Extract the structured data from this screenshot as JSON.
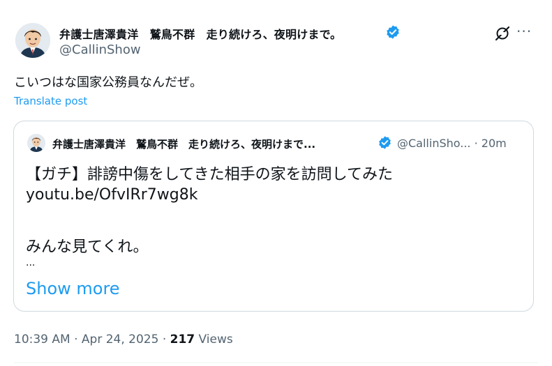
{
  "post": {
    "author_name": "弁護士唐澤貴洋　鷲鳥不群　走り続けろ、夜明けまで。",
    "author_handle": "@CallinShow",
    "text": "こいつはな国家公務員なんだぜ。",
    "translate_label": "Translate post",
    "more_icon": "more-icon",
    "grok_icon": "grok-icon"
  },
  "quote": {
    "author_name": "弁護士唐澤貴洋　鷲鳥不群　走り続けろ、夜明けまで...",
    "author_handle": "@CallinSho...",
    "time": "· 20m",
    "line1": "【ガチ】誹謗中傷をしてきた相手の家を訪問してみた",
    "line2": "youtu.be/OfvIRr7wg8k",
    "line3": "みんな見てくれ。",
    "ellipsis": "...",
    "show_more": "Show more"
  },
  "meta": {
    "timestamp": "10:39 AM · Apr 24, 2025 · ",
    "views_count": "217",
    "views_label": " Views"
  },
  "colors": {
    "accent": "#1d9bf0",
    "secondary_text": "#536471",
    "border": "#cfd9de"
  }
}
